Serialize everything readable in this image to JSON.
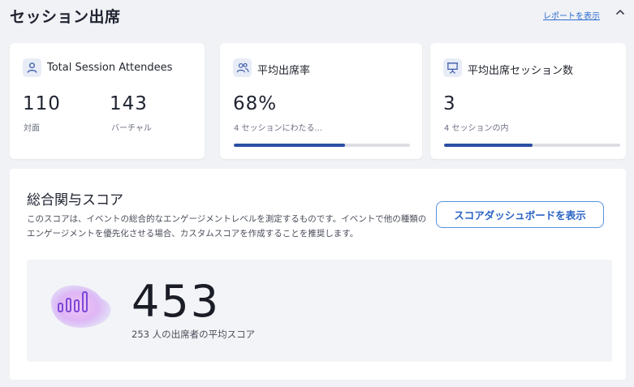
{
  "header": {
    "title": "セッション出席",
    "report_link": "レポートを表示",
    "collapse_icon": "chevron-up-icon"
  },
  "cards": [
    {
      "title": "Total Session Attendees",
      "icon": "user-icon",
      "stats": [
        {
          "value": "110",
          "label": "対面"
        },
        {
          "value": "143",
          "label": "バーチャル"
        }
      ]
    },
    {
      "title": "平均出席率",
      "icon": "users-icon",
      "value": "68%",
      "label": "4 セッションにわたる...",
      "progress": 0.63
    },
    {
      "title": "平均出席セッション数",
      "icon": "presentation-icon",
      "value": "3",
      "label": "4 セッションの内",
      "progress": 0.5
    }
  ],
  "score": {
    "title": "総合関与スコア",
    "description": "このスコアは、イベントの総合的なエンゲージメントレベルを測定するものです。イベントで他の種類のエンゲージメントを優先化させる場合、カスタムスコアを作成することを推奨します。",
    "button_label": "スコアダッシュボードを表示",
    "value": "453",
    "caption": "253 人の出席者の平均スコア",
    "graphic_icon": "bar-chart-icon"
  },
  "colors": {
    "accent": "#2a63c4",
    "progress_fill": "#2b4fa3",
    "progress_track": "#dcdee3",
    "icon_bg": "#e7ecf7"
  }
}
